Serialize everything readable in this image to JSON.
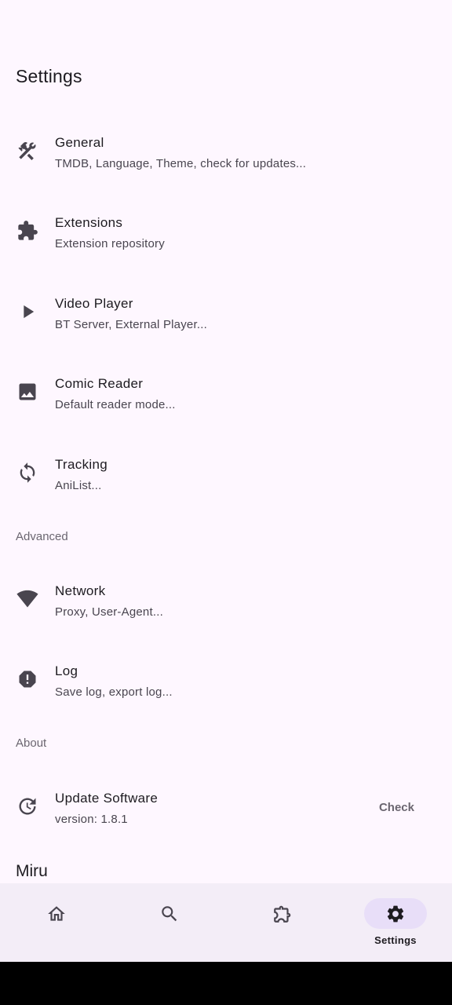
{
  "page_title": "Settings",
  "items": [
    {
      "title": "General",
      "subtitle": "TMDB, Language, Theme, check for updates...",
      "icon": "tools-icon"
    },
    {
      "title": "Extensions",
      "subtitle": "Extension repository",
      "icon": "extension-icon"
    },
    {
      "title": "Video Player",
      "subtitle": "BT Server, External Player...",
      "icon": "play-icon"
    },
    {
      "title": "Comic Reader",
      "subtitle": "Default reader mode...",
      "icon": "image-icon"
    },
    {
      "title": "Tracking",
      "subtitle": "AniList...",
      "icon": "sync-icon"
    }
  ],
  "advanced": {
    "header": "Advanced",
    "items": [
      {
        "title": "Network",
        "subtitle": "Proxy, User-Agent...",
        "icon": "wifi-icon"
      },
      {
        "title": "Log",
        "subtitle": "Save log, export log...",
        "icon": "alert-icon"
      }
    ]
  },
  "about": {
    "header": "About",
    "update": {
      "title": "Update Software",
      "subtitle": "version: 1.8.1",
      "action": "Check",
      "icon": "update-icon"
    }
  },
  "footer_brand": "Miru",
  "nav": {
    "items": [
      {
        "icon": "home-icon",
        "label": ""
      },
      {
        "icon": "search-icon",
        "label": ""
      },
      {
        "icon": "extension-icon",
        "label": ""
      },
      {
        "icon": "settings-icon",
        "label": "Settings",
        "active": true
      }
    ]
  }
}
